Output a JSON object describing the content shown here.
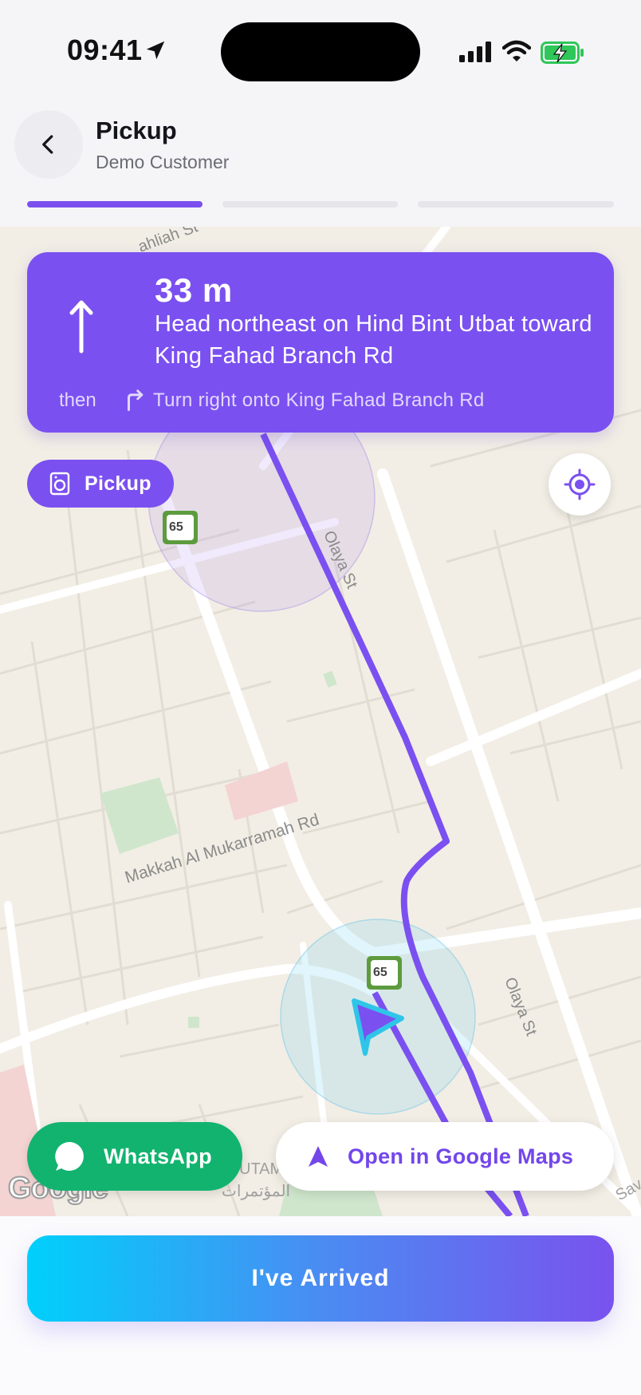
{
  "status_bar": {
    "time": "09:41"
  },
  "header": {
    "title": "Pickup",
    "subtitle": "Demo Customer"
  },
  "navigation": {
    "distance": "33 m",
    "instruction": "Head northeast on Hind Bint Utbat toward King Fahad Branch Rd",
    "then_label": "then",
    "next_instruction": "Turn right onto King Fahad Branch Rd"
  },
  "map": {
    "pickup_label": "Pickup",
    "route_shield": "65",
    "streets": {
      "top": "ahliah St",
      "olaya_1": "Olaya St",
      "olaya_2": "Olaya St",
      "makkah": "Makkah Al Mukarramah Rd"
    },
    "poi_en": "UTAM",
    "poi_ar": "المؤتمرات",
    "corner": "Sav",
    "attribution": "Google",
    "route_color": "#7b50f0"
  },
  "actions": {
    "whatsapp_label": "WhatsApp",
    "google_maps_label": "Open in Google Maps",
    "arrived_label": "I've Arrived"
  },
  "colors": {
    "primary": "#7b50f0",
    "whatsapp": "#12b36f",
    "gradient_start": "#00d0fb",
    "gradient_end": "#7a52ee"
  }
}
